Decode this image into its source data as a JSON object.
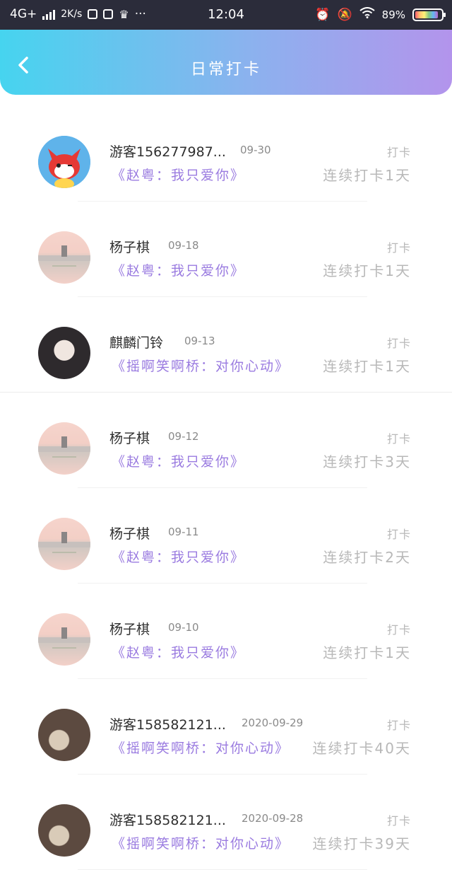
{
  "status_bar": {
    "network": "4G+",
    "speed": "2K/s",
    "time": "12:04",
    "battery": "89%",
    "battery_level": 0.89
  },
  "header": {
    "title": "日常打卡",
    "back_icon": "chevron-left-icon"
  },
  "entries": [
    {
      "name": "游客156277987...",
      "date": "09-30",
      "subtitle": "《赵粤：我只爱你》",
      "tag": "打卡",
      "streak": "连续打卡1天",
      "avatar": "fox"
    },
    {
      "name": "杨子棋",
      "date": "09-18",
      "subtitle": "《赵粤：我只爱你》",
      "tag": "打卡",
      "streak": "连续打卡1天",
      "avatar": "pink"
    },
    {
      "name": "麒麟门铃",
      "date": "09-13",
      "subtitle": "《摇啊笑啊桥：对你心动》",
      "tag": "打卡",
      "streak": "连续打卡1天",
      "avatar": "man"
    },
    {
      "name": "杨子棋",
      "date": "09-12",
      "subtitle": "《赵粤：我只爱你》",
      "tag": "打卡",
      "streak": "连续打卡3天",
      "avatar": "pink"
    },
    {
      "name": "杨子棋",
      "date": "09-11",
      "subtitle": "《赵粤：我只爱你》",
      "tag": "打卡",
      "streak": "连续打卡2天",
      "avatar": "pink"
    },
    {
      "name": "杨子棋",
      "date": "09-10",
      "subtitle": "《赵粤：我只爱你》",
      "tag": "打卡",
      "streak": "连续打卡1天",
      "avatar": "pink"
    },
    {
      "name": "游客158582121...",
      "date": "2020-09-29",
      "subtitle": "《摇啊笑啊桥：对你心动》",
      "tag": "打卡",
      "streak": "连续打卡40天",
      "avatar": "cat"
    },
    {
      "name": "游客158582121...",
      "date": "2020-09-28",
      "subtitle": "《摇啊笑啊桥：对你心动》",
      "tag": "打卡",
      "streak": "连续打卡39天",
      "avatar": "cat"
    }
  ]
}
